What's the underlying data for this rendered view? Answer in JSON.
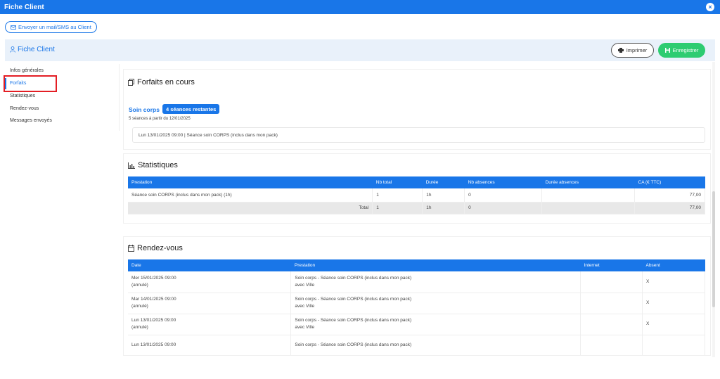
{
  "window": {
    "title": "Fiche Client",
    "close_icon": "×"
  },
  "mail_button": {
    "label": "Envoyer un mail/SMS au Client"
  },
  "header": {
    "title": "Fiche Client",
    "print_label": "Imprimer",
    "save_label": "Enregistrer"
  },
  "sidebar": {
    "items": [
      {
        "label": "Infos générales"
      },
      {
        "label": "Forfaits"
      },
      {
        "label": "Statistiques"
      },
      {
        "label": "Rendez-vous"
      },
      {
        "label": "Messages envoyés"
      }
    ]
  },
  "forfaits": {
    "title": "Forfaits en cours",
    "name": "Soin corps",
    "badge": "4 séances restantes",
    "subtitle": "5 séances à partir du 12/01/2025",
    "session": "Lun 13/01/2025 09:00 | Séance soin CORPS (inclus dans mon pack)"
  },
  "statistiques": {
    "title": "Statistiques",
    "columns": [
      "Prestation",
      "Nb total",
      "Durée",
      "Nb absences",
      "Durée absences",
      "CA (€ TTC)"
    ],
    "row": {
      "prestation": "Séance soin CORPS (inclus dans mon pack) (1h)",
      "nb_total": "1",
      "duree": "1h",
      "nb_absences": "0",
      "duree_absences": "",
      "ca": "77,00"
    },
    "total": {
      "label": "Total",
      "nb_total": "1",
      "duree": "1h",
      "nb_absences": "0",
      "duree_absences": "",
      "ca": "77,00"
    }
  },
  "rendezvous": {
    "title": "Rendez-vous",
    "columns": [
      "Date",
      "Prestation",
      "Internet",
      "Absent"
    ],
    "rows": [
      {
        "date": "Mer 15/01/2025 09:00",
        "status": "(annulé)",
        "prestation": "Soin corps - Séance soin CORPS (inclus dans mon pack)",
        "with": "avec Ville",
        "internet": "",
        "absent": "X"
      },
      {
        "date": "Mar 14/01/2025 09:00",
        "status": "(annulé)",
        "prestation": "Soin corps - Séance soin CORPS (inclus dans mon pack)",
        "with": "avec Ville",
        "internet": "",
        "absent": "X"
      },
      {
        "date": "Lun 13/01/2025 09:00",
        "status": "(annulé)",
        "prestation": "Soin corps - Séance soin CORPS (inclus dans mon pack)",
        "with": "avec Ville",
        "internet": "",
        "absent": "X"
      },
      {
        "date": "Lun 13/01/2025 09:00",
        "status": "",
        "prestation": "Soin corps - Séance soin CORPS (inclus dans mon pack)",
        "with": "",
        "internet": "",
        "absent": ""
      }
    ]
  },
  "colors": {
    "primary": "#1976e8",
    "success": "#2ecc71",
    "highlight": "#e31e24",
    "header_bg": "#e9f1fa"
  }
}
